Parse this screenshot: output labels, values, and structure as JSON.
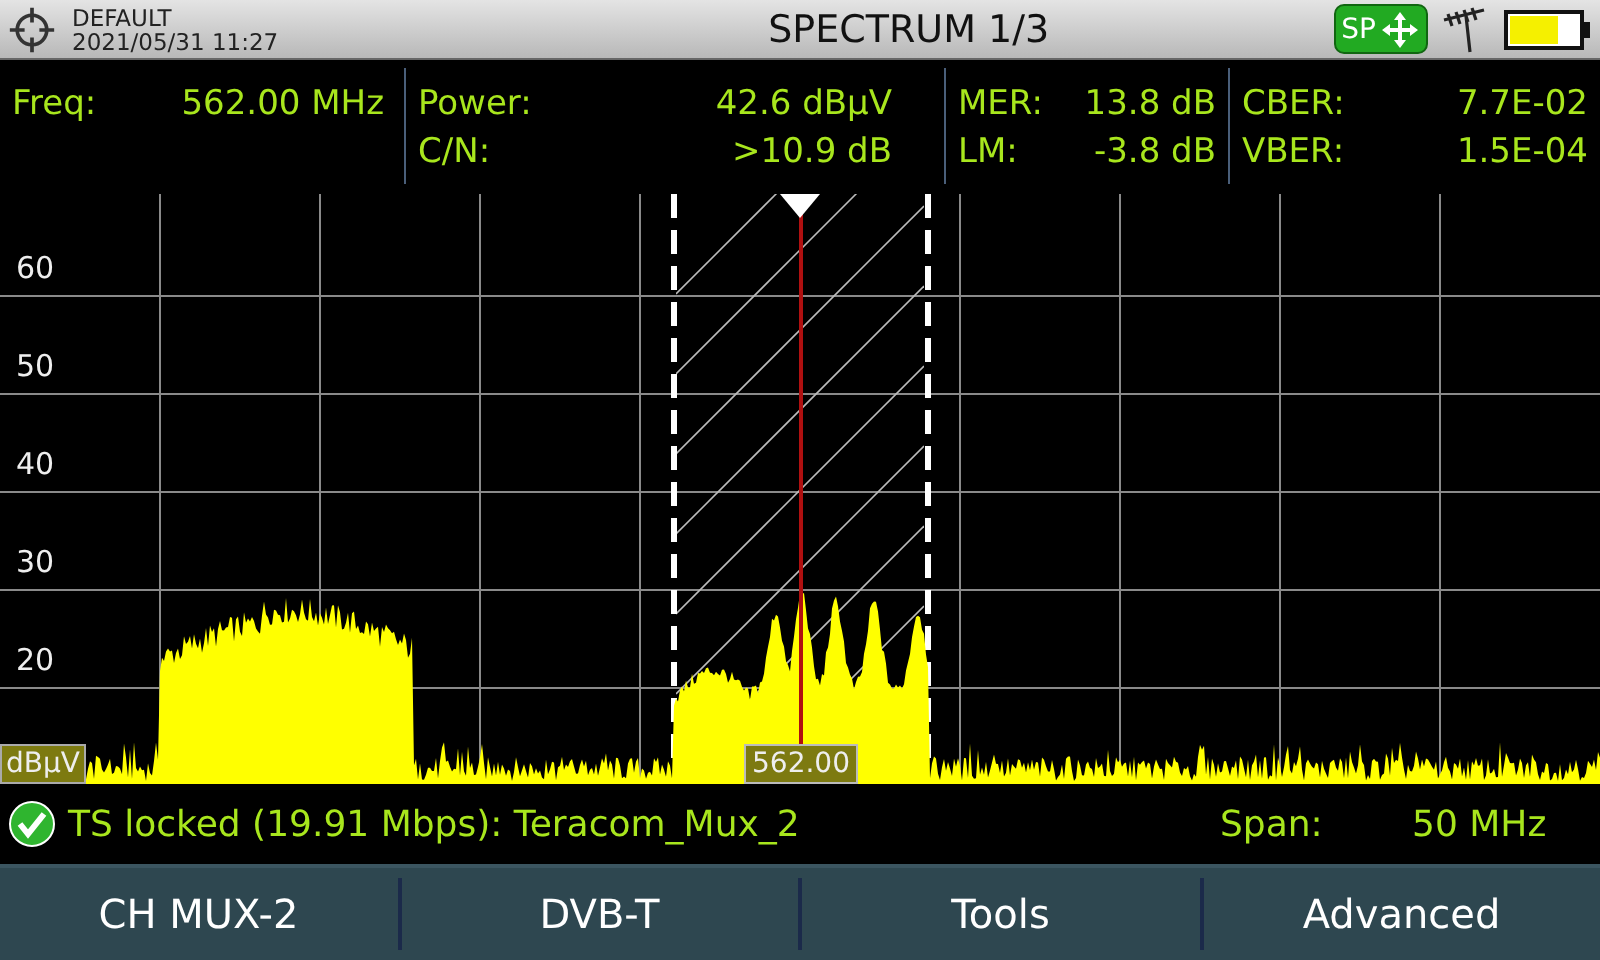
{
  "header": {
    "profile": "DEFAULT",
    "datetime": "2021/05/31 11:27",
    "title": "SPECTRUM 1/3",
    "mode_badge": "SP"
  },
  "measurement_columns": [
    [
      {
        "label": "Freq:",
        "value": "562.00 MHz"
      }
    ],
    [
      {
        "label": "Power:",
        "value": "42.6 dBµV"
      },
      {
        "label": "C/N:",
        "value": ">10.9 dB"
      }
    ],
    [
      {
        "label": "MER:",
        "value": "13.8 dB"
      },
      {
        "label": "LM:",
        "value": "-3.8 dB"
      }
    ],
    [
      {
        "label": "CBER:",
        "value": "7.7E-02"
      },
      {
        "label": "VBER:",
        "value": "1.5E-04"
      }
    ]
  ],
  "chart": {
    "unit": "dBµV",
    "yticks": [
      "60",
      "50",
      "40",
      "30",
      "20"
    ],
    "marker_label": "562.00"
  },
  "status": {
    "locked": true,
    "text": "TS locked (19.91 Mbps): Teracom_Mux_2",
    "span_label": "Span:",
    "span_value": "50 MHz"
  },
  "softkeys": [
    "CH MUX-2",
    "DVB-T",
    "Tools",
    "Advanced"
  ]
}
